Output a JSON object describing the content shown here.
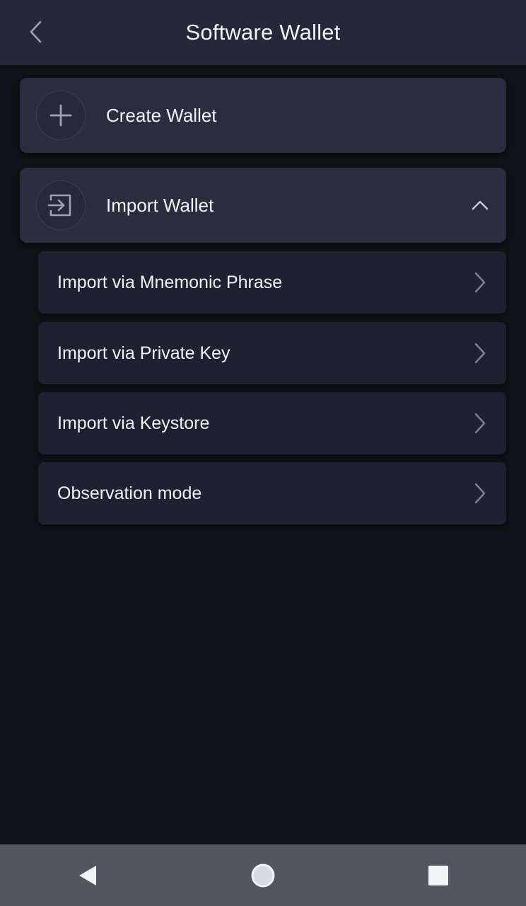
{
  "header": {
    "title": "Software Wallet",
    "back_icon": "chevron-left-icon"
  },
  "cards": {
    "create": {
      "label": "Create Wallet",
      "icon": "plus-icon"
    },
    "import": {
      "label": "Import Wallet",
      "icon": "import-login-icon",
      "expanded": true,
      "toggle_icon": "chevron-up-icon"
    }
  },
  "import_options": [
    {
      "label": "Import via Mnemonic Phrase",
      "icon": "chevron-right-icon"
    },
    {
      "label": "Import via Private Key",
      "icon": "chevron-right-icon"
    },
    {
      "label": "Import via Keystore",
      "icon": "chevron-right-icon"
    },
    {
      "label": "Observation mode",
      "icon": "chevron-right-icon"
    }
  ],
  "navbar": {
    "back": "nav-back-icon",
    "home": "nav-home-icon",
    "recents": "nav-recents-icon"
  },
  "colors": {
    "background": "#0f1117",
    "header": "#252837",
    "card": "#2a2d3e",
    "sub_item": "#1f2130",
    "navbar": "#54565f",
    "text": "#f2f3f7",
    "icon": "#9ea2b3"
  }
}
